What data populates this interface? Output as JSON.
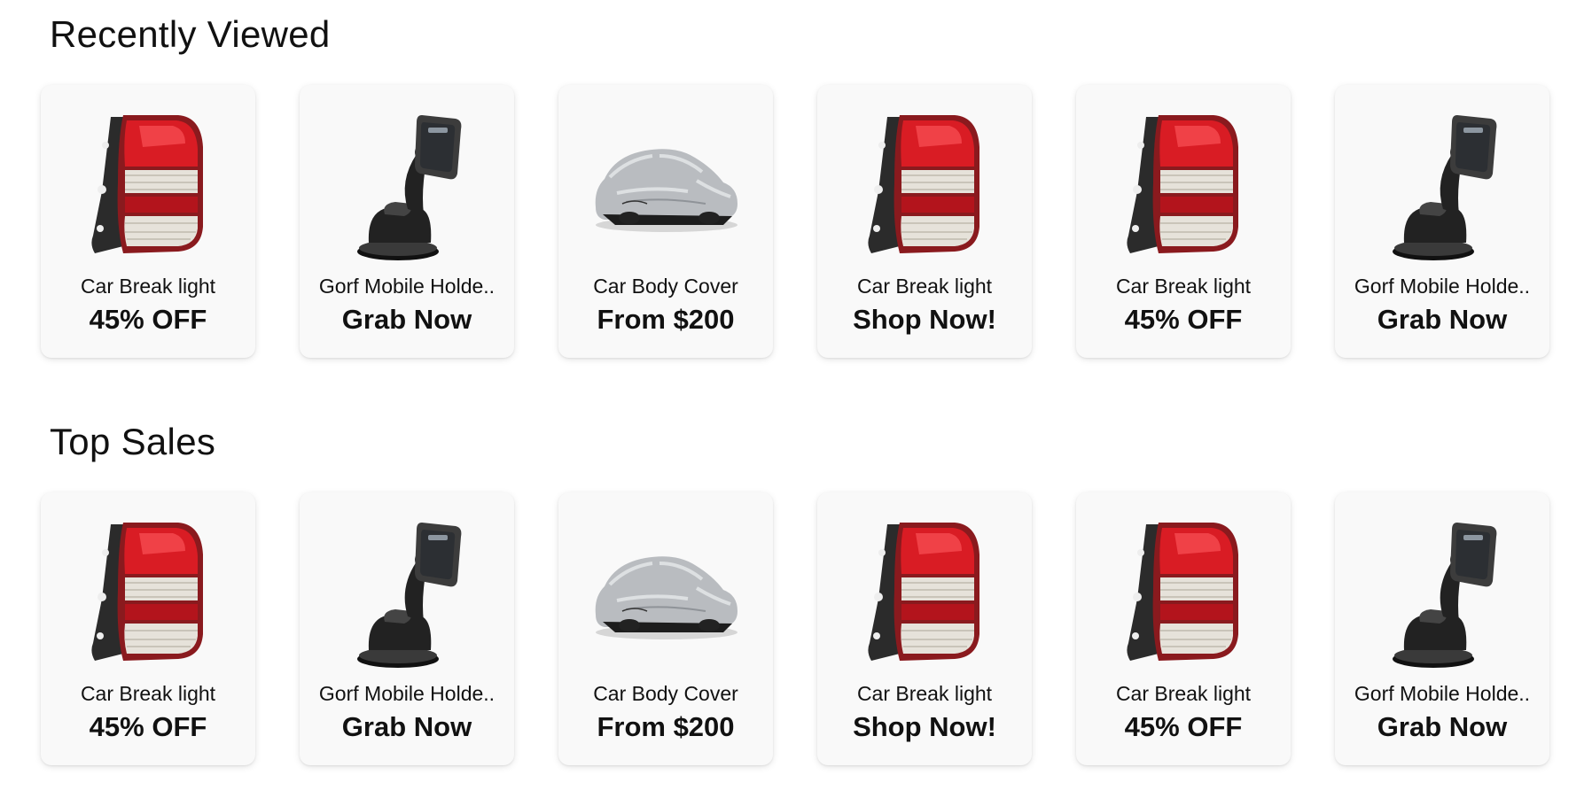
{
  "sections": [
    {
      "title": "Recently Viewed",
      "items": [
        {
          "name": "Car Break light",
          "offer": "45% OFF",
          "icon": "tail-light-icon"
        },
        {
          "name": "Gorf Mobile Holde..",
          "offer": "Grab Now",
          "icon": "phone-holder-icon"
        },
        {
          "name": "Car Body Cover",
          "offer": "From $200",
          "icon": "car-cover-icon"
        },
        {
          "name": "Car Break light",
          "offer": "Shop Now!",
          "icon": "tail-light-icon"
        },
        {
          "name": "Car Break light",
          "offer": "45% OFF",
          "icon": "tail-light-icon"
        },
        {
          "name": "Gorf Mobile Holde..",
          "offer": "Grab Now",
          "icon": "phone-holder-icon"
        }
      ]
    },
    {
      "title": "Top Sales",
      "items": [
        {
          "name": "Car Break light",
          "offer": "45% OFF",
          "icon": "tail-light-icon"
        },
        {
          "name": "Gorf Mobile Holde..",
          "offer": "Grab Now",
          "icon": "phone-holder-icon"
        },
        {
          "name": "Car Body Cover",
          "offer": "From $200",
          "icon": "car-cover-icon"
        },
        {
          "name": "Car Break light",
          "offer": "Shop Now!",
          "icon": "tail-light-icon"
        },
        {
          "name": "Car Break light",
          "offer": "45% OFF",
          "icon": "tail-light-icon"
        },
        {
          "name": "Gorf Mobile Holde..",
          "offer": "Grab Now",
          "icon": "phone-holder-icon"
        }
      ]
    }
  ],
  "colors": {
    "card_bg": "#f9f9f9",
    "text": "#111111",
    "tail_light_red": "#d91c24",
    "tail_light_housing": "#2b2b2b",
    "holder_black": "#222222",
    "cover_silver": "#b9bcc0"
  }
}
